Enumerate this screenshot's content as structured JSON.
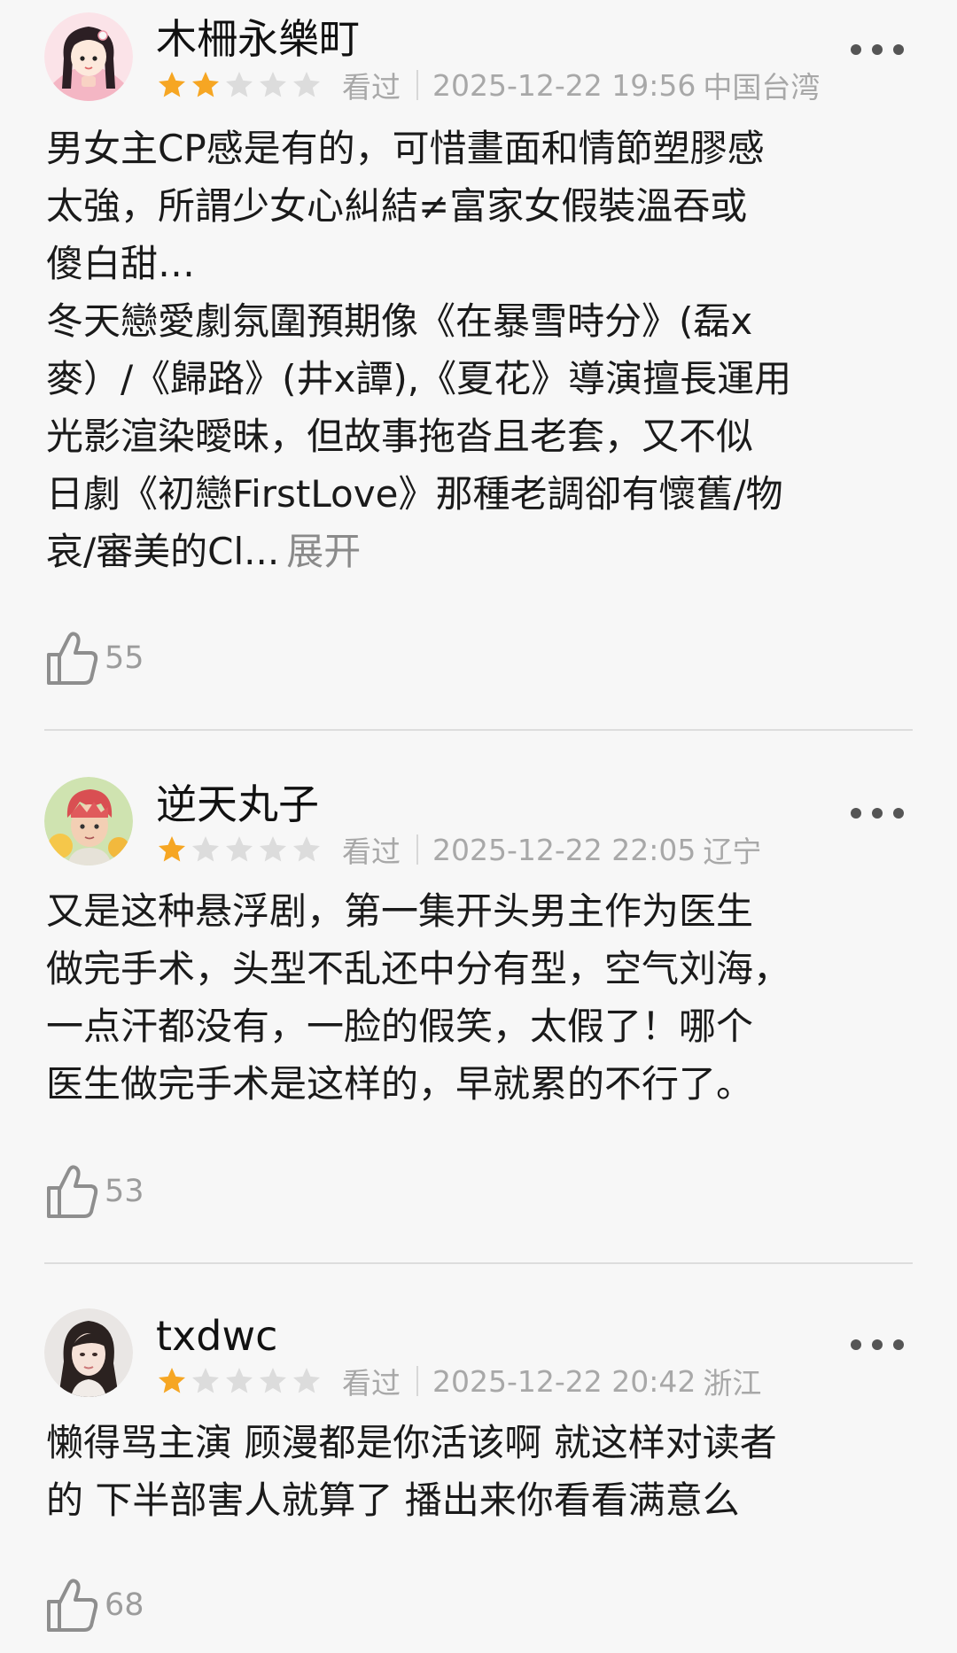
{
  "reviews": [
    {
      "username": "木柵永樂町",
      "rating": 2,
      "max_rating": 5,
      "status": "看过",
      "datetime": "2025-12-22 19:56",
      "location": "中国台湾",
      "lines": [
        "男女主CP感是有的，可惜畫面和情節塑膠感",
        "太強，所謂少女心糾結≠富家女假裝溫吞或",
        "傻白甜…",
        "冬天戀愛劇氛圍預期像《在暴雪時分》(磊x",
        "麥）/《歸路》(井x譚),《夏花》導演擅長運用",
        "光影渲染曖昧，但故事拖沓且老套，又不似",
        "日劇《初戀FirstLove》那種老調卻有懷舊/物",
        "哀/審美的Cl..."
      ],
      "expand_label": "展开",
      "likes": "55",
      "avatar_icon": "anime-girl-avatar"
    },
    {
      "username": "逆天丸子",
      "rating": 1,
      "max_rating": 5,
      "status": "看过",
      "datetime": "2025-12-22 22:05",
      "location": "辽宁",
      "lines": [
        "又是这种悬浮剧，第一集开头男主作为医生",
        "做完手术，头型不乱还中分有型，空气刘海，",
        "一点汗都没有，一脸的假笑，太假了！哪个",
        "医生做完手术是这样的，早就累的不行了。"
      ],
      "likes": "53",
      "avatar_icon": "anime-boy-avatar"
    },
    {
      "username": "txdwc",
      "rating": 1,
      "max_rating": 5,
      "status": "看过",
      "datetime": "2025-12-22 20:42",
      "location": "浙江",
      "lines": [
        "懒得骂主演 顾漫都是你活该啊 就这样对读者",
        "的 下半部害人就算了 播出来你看看满意么"
      ],
      "likes": "68",
      "avatar_icon": "woman-photo-avatar"
    }
  ],
  "colors": {
    "star_filled": "#f6a623",
    "star_empty": "#dcdcdc",
    "meta_text": "#a8a8a8",
    "body_text": "#1a1a1a"
  },
  "icons": {
    "more": "more-dots-icon",
    "like": "thumbs-up-icon",
    "star": "star-icon"
  }
}
